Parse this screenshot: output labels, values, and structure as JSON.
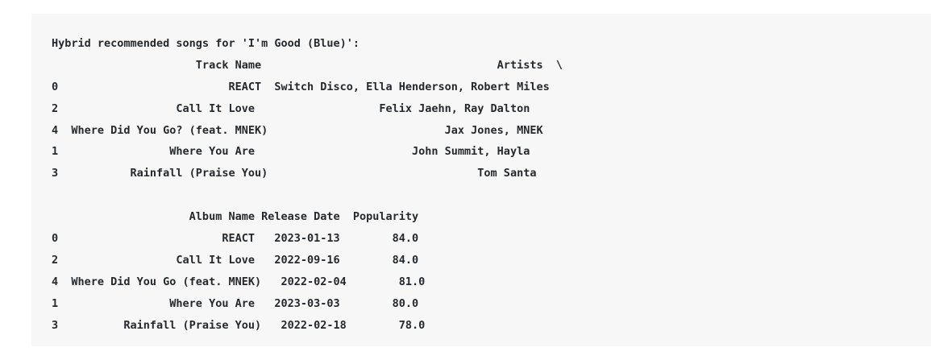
{
  "output": {
    "lines": [
      "Hybrid recommended songs for 'I'm Good (Blue)':",
      "                      Track Name                                    Artists  \\",
      "0                          REACT  Switch Disco, Ella Henderson, Robert Miles",
      "2                  Call It Love                   Felix Jaehn, Ray Dalton",
      "4  Where Did You Go? (feat. MNEK)                           Jax Jones, MNEK",
      "1                 Where You Are                        John Summit, Hayla",
      "3           Rainfall (Praise You)                                Tom Santa",
      "",
      "                     Album Name Release Date  Popularity",
      "0                         REACT   2023-01-13        84.0",
      "2                  Call It Love   2022-09-16        84.0",
      "4  Where Did You Go (feat. MNEK)   2022-02-04        81.0",
      "1                 Where You Are   2023-03-03        80.0",
      "3          Rainfall (Praise You)   2022-02-18        78.0"
    ]
  }
}
